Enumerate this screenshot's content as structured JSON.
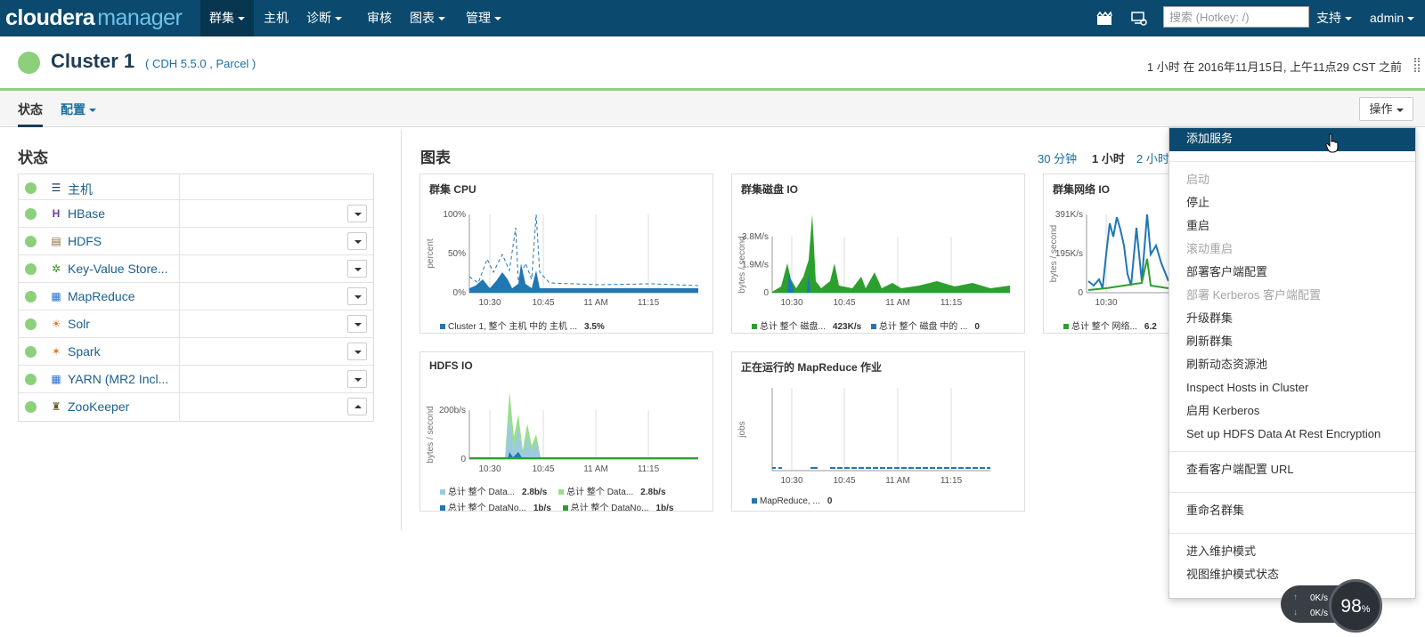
{
  "nav": {
    "brand_main": "cloudera",
    "brand_sub": "manager",
    "items": [
      "群集",
      "主机",
      "诊断",
      "审核",
      "图表",
      "管理"
    ],
    "search_placeholder": "搜索 (Hotkey: /)",
    "support": "支持",
    "user": "admin"
  },
  "cluster": {
    "name": "Cluster 1",
    "version": "( CDH 5.5.0 , Parcel )",
    "time": "1 小时 在 2016年11月15日, 上午11点29 CST 之前",
    "status_color": "#8cd07c"
  },
  "tabs": {
    "status": "状态",
    "config": "配置",
    "actions": "操作"
  },
  "status": {
    "title": "状态",
    "services": [
      {
        "name": "主机",
        "icon": "hosts-icon"
      },
      {
        "name": "HBase",
        "icon": "hbase-icon"
      },
      {
        "name": "HDFS",
        "icon": "hdfs-icon"
      },
      {
        "name": "Key-Value Store...",
        "icon": "key-value-store-icon"
      },
      {
        "name": "MapReduce",
        "icon": "mapreduce-icon"
      },
      {
        "name": "Solr",
        "icon": "solr-icon"
      },
      {
        "name": "Spark",
        "icon": "spark-icon"
      },
      {
        "name": "YARN (MR2 Incl...",
        "icon": "yarn-icon"
      },
      {
        "name": "ZooKeeper",
        "icon": "zookeeper-icon"
      }
    ]
  },
  "charts": {
    "title": "图表",
    "ranges": [
      "30 分钟",
      "1 小时",
      "2 小时"
    ],
    "cpu": {
      "title": "群集 CPU",
      "ylabel": "percent",
      "yticks": [
        "100%",
        "50%",
        "0%"
      ],
      "xticks": [
        "10:30",
        "10:45",
        "11 AM",
        "11:15"
      ],
      "legend_name": "Cluster 1, 整个 主机 中的 主机 ...",
      "legend_value": "3.5%"
    },
    "disk": {
      "title": "群集磁盘 IO",
      "ylabel": "bytes / second",
      "yticks": [
        "3.8M/s",
        "1.9M/s",
        "0"
      ],
      "xticks": [
        "10:30",
        "10:45",
        "11 AM",
        "11:15"
      ],
      "legend": [
        {
          "name": "总计 整个 磁盘...",
          "value": "423K/s",
          "color": "#2ca02c"
        },
        {
          "name": "总计 整个 磁盘 中的 ...",
          "value": "0",
          "color": "#1f77b4"
        }
      ]
    },
    "net": {
      "title": "群集网络 IO",
      "ylabel": "bytes / second",
      "yticks": [
        "391K/s",
        "195K/s",
        "0"
      ],
      "xticks": [
        "10:30"
      ],
      "legend_name": "总计 整个 网络...",
      "legend_value": "6.2"
    },
    "hdfs": {
      "title": "HDFS IO",
      "ylabel": "bytes / second",
      "yticks": [
        "200b/s",
        "0"
      ],
      "xticks": [
        "10:30",
        "10:45",
        "11 AM",
        "11:15"
      ],
      "legend": [
        {
          "name": "总计 整个 Data...",
          "value": "2.8b/s",
          "color": "#9ecae1"
        },
        {
          "name": "总计 整个 Data...",
          "value": "2.8b/s",
          "color": "#98df8a"
        },
        {
          "name": "总计 整个 DataNo...",
          "value": "1b/s",
          "color": "#1f77b4"
        },
        {
          "name": "总计 整个 DataNo...",
          "value": "1b/s",
          "color": "#2ca02c"
        }
      ]
    },
    "mr": {
      "title": "正在运行的 MapReduce 作业",
      "ylabel": "jobs",
      "xticks": [
        "10:30",
        "10:45",
        "11 AM",
        "11:15"
      ],
      "legend_name": "MapReduce, ...",
      "legend_value": "0"
    }
  },
  "menu": {
    "items": [
      {
        "label": "添加服务",
        "state": "highlight"
      },
      {
        "label": "启动",
        "state": "disabled"
      },
      {
        "label": "停止",
        "state": "normal"
      },
      {
        "label": "重启",
        "state": "normal"
      },
      {
        "label": "滚动重启",
        "state": "disabled"
      },
      {
        "label": "部署客户端配置",
        "state": "normal"
      },
      {
        "label": "部署 Kerberos 客户端配置",
        "state": "disabled"
      },
      {
        "label": "升级群集",
        "state": "normal"
      },
      {
        "label": "刷新群集",
        "state": "normal"
      },
      {
        "label": "刷新动态资源池",
        "state": "normal"
      },
      {
        "label": "Inspect Hosts in Cluster",
        "state": "normal"
      },
      {
        "label": "启用 Kerberos",
        "state": "normal"
      },
      {
        "label": "Set up HDFS Data At Rest Encryption",
        "state": "normal"
      },
      {
        "label": "查看客户端配置 URL",
        "state": "normal"
      },
      {
        "label": "重命名群集",
        "state": "normal"
      },
      {
        "label": "进入维护模式",
        "state": "normal"
      },
      {
        "label": "视图维护模式状态",
        "state": "normal"
      }
    ]
  },
  "widget": {
    "up": "0K/s",
    "down": "0K/s",
    "gauge": "98",
    "gauge_unit": "%"
  },
  "colors": {
    "nav_bg": "#0b4a6e",
    "link": "#1a6fa0",
    "green": "#8cd07c",
    "series_blue": "#1f77b4",
    "series_green": "#2ca02c"
  }
}
